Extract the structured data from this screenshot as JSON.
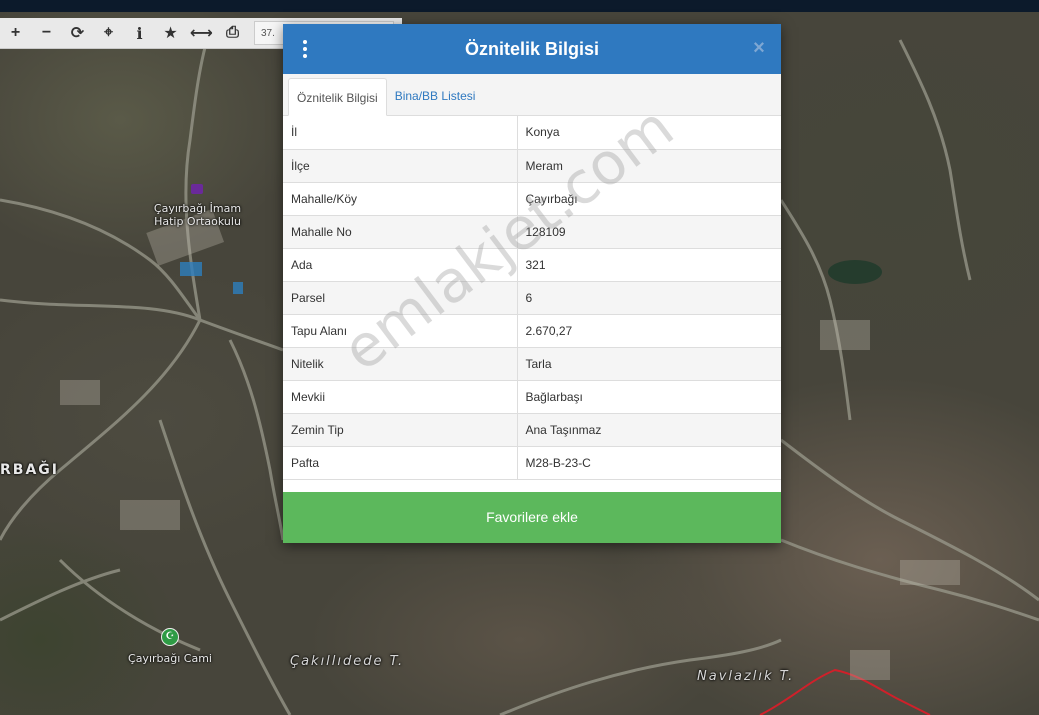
{
  "toolbar": {
    "coord_text": "37.",
    "buttons": [
      {
        "icon": "plus-icon",
        "glyph": "+"
      },
      {
        "icon": "minus-icon",
        "glyph": "−"
      },
      {
        "icon": "refresh-icon",
        "glyph": "⟳"
      },
      {
        "icon": "crosshair-icon",
        "glyph": "⌖"
      },
      {
        "icon": "info-icon",
        "glyph": "i"
      },
      {
        "icon": "star-icon",
        "glyph": "★"
      },
      {
        "icon": "measure-icon",
        "glyph": "⟷"
      },
      {
        "icon": "print-icon",
        "glyph": "⎙"
      }
    ]
  },
  "map": {
    "labels": {
      "school": "Çayırbağı İmam Hatip Ortaokulu",
      "village": "RBAĞI",
      "mosque": "Çayırbağı Cami",
      "hill1": "Çakıllıdede T.",
      "hill2": "Navlazlık T."
    },
    "colors": {
      "road": "#9a9a8c",
      "boundary": "#d0202a"
    }
  },
  "modal": {
    "title": "Öznitelik Bilgisi",
    "close_glyph": "×",
    "tabs": [
      {
        "label": "Öznitelik Bilgisi",
        "active": true
      },
      {
        "label": "Bina/BB Listesi",
        "active": false
      }
    ],
    "rows": [
      {
        "key": "İl",
        "value": "Konya"
      },
      {
        "key": "İlçe",
        "value": "Meram"
      },
      {
        "key": "Mahalle/Köy",
        "value": "Çayırbağı"
      },
      {
        "key": "Mahalle No",
        "value": "128109"
      },
      {
        "key": "Ada",
        "value": "321"
      },
      {
        "key": "Parsel",
        "value": "6"
      },
      {
        "key": "Tapu Alanı",
        "value": "2.670,27"
      },
      {
        "key": "Nitelik",
        "value": "Tarla"
      },
      {
        "key": "Mevkii",
        "value": "Bağlarbaşı"
      },
      {
        "key": "Zemin Tip",
        "value": "Ana Taşınmaz"
      },
      {
        "key": "Pafta",
        "value": "M28-B-23-C"
      }
    ],
    "favorite_label": "Favorilere ekle",
    "header_color": "#2f79c0",
    "favorite_color": "#5cb85c"
  },
  "watermark": "emlakjet.com"
}
